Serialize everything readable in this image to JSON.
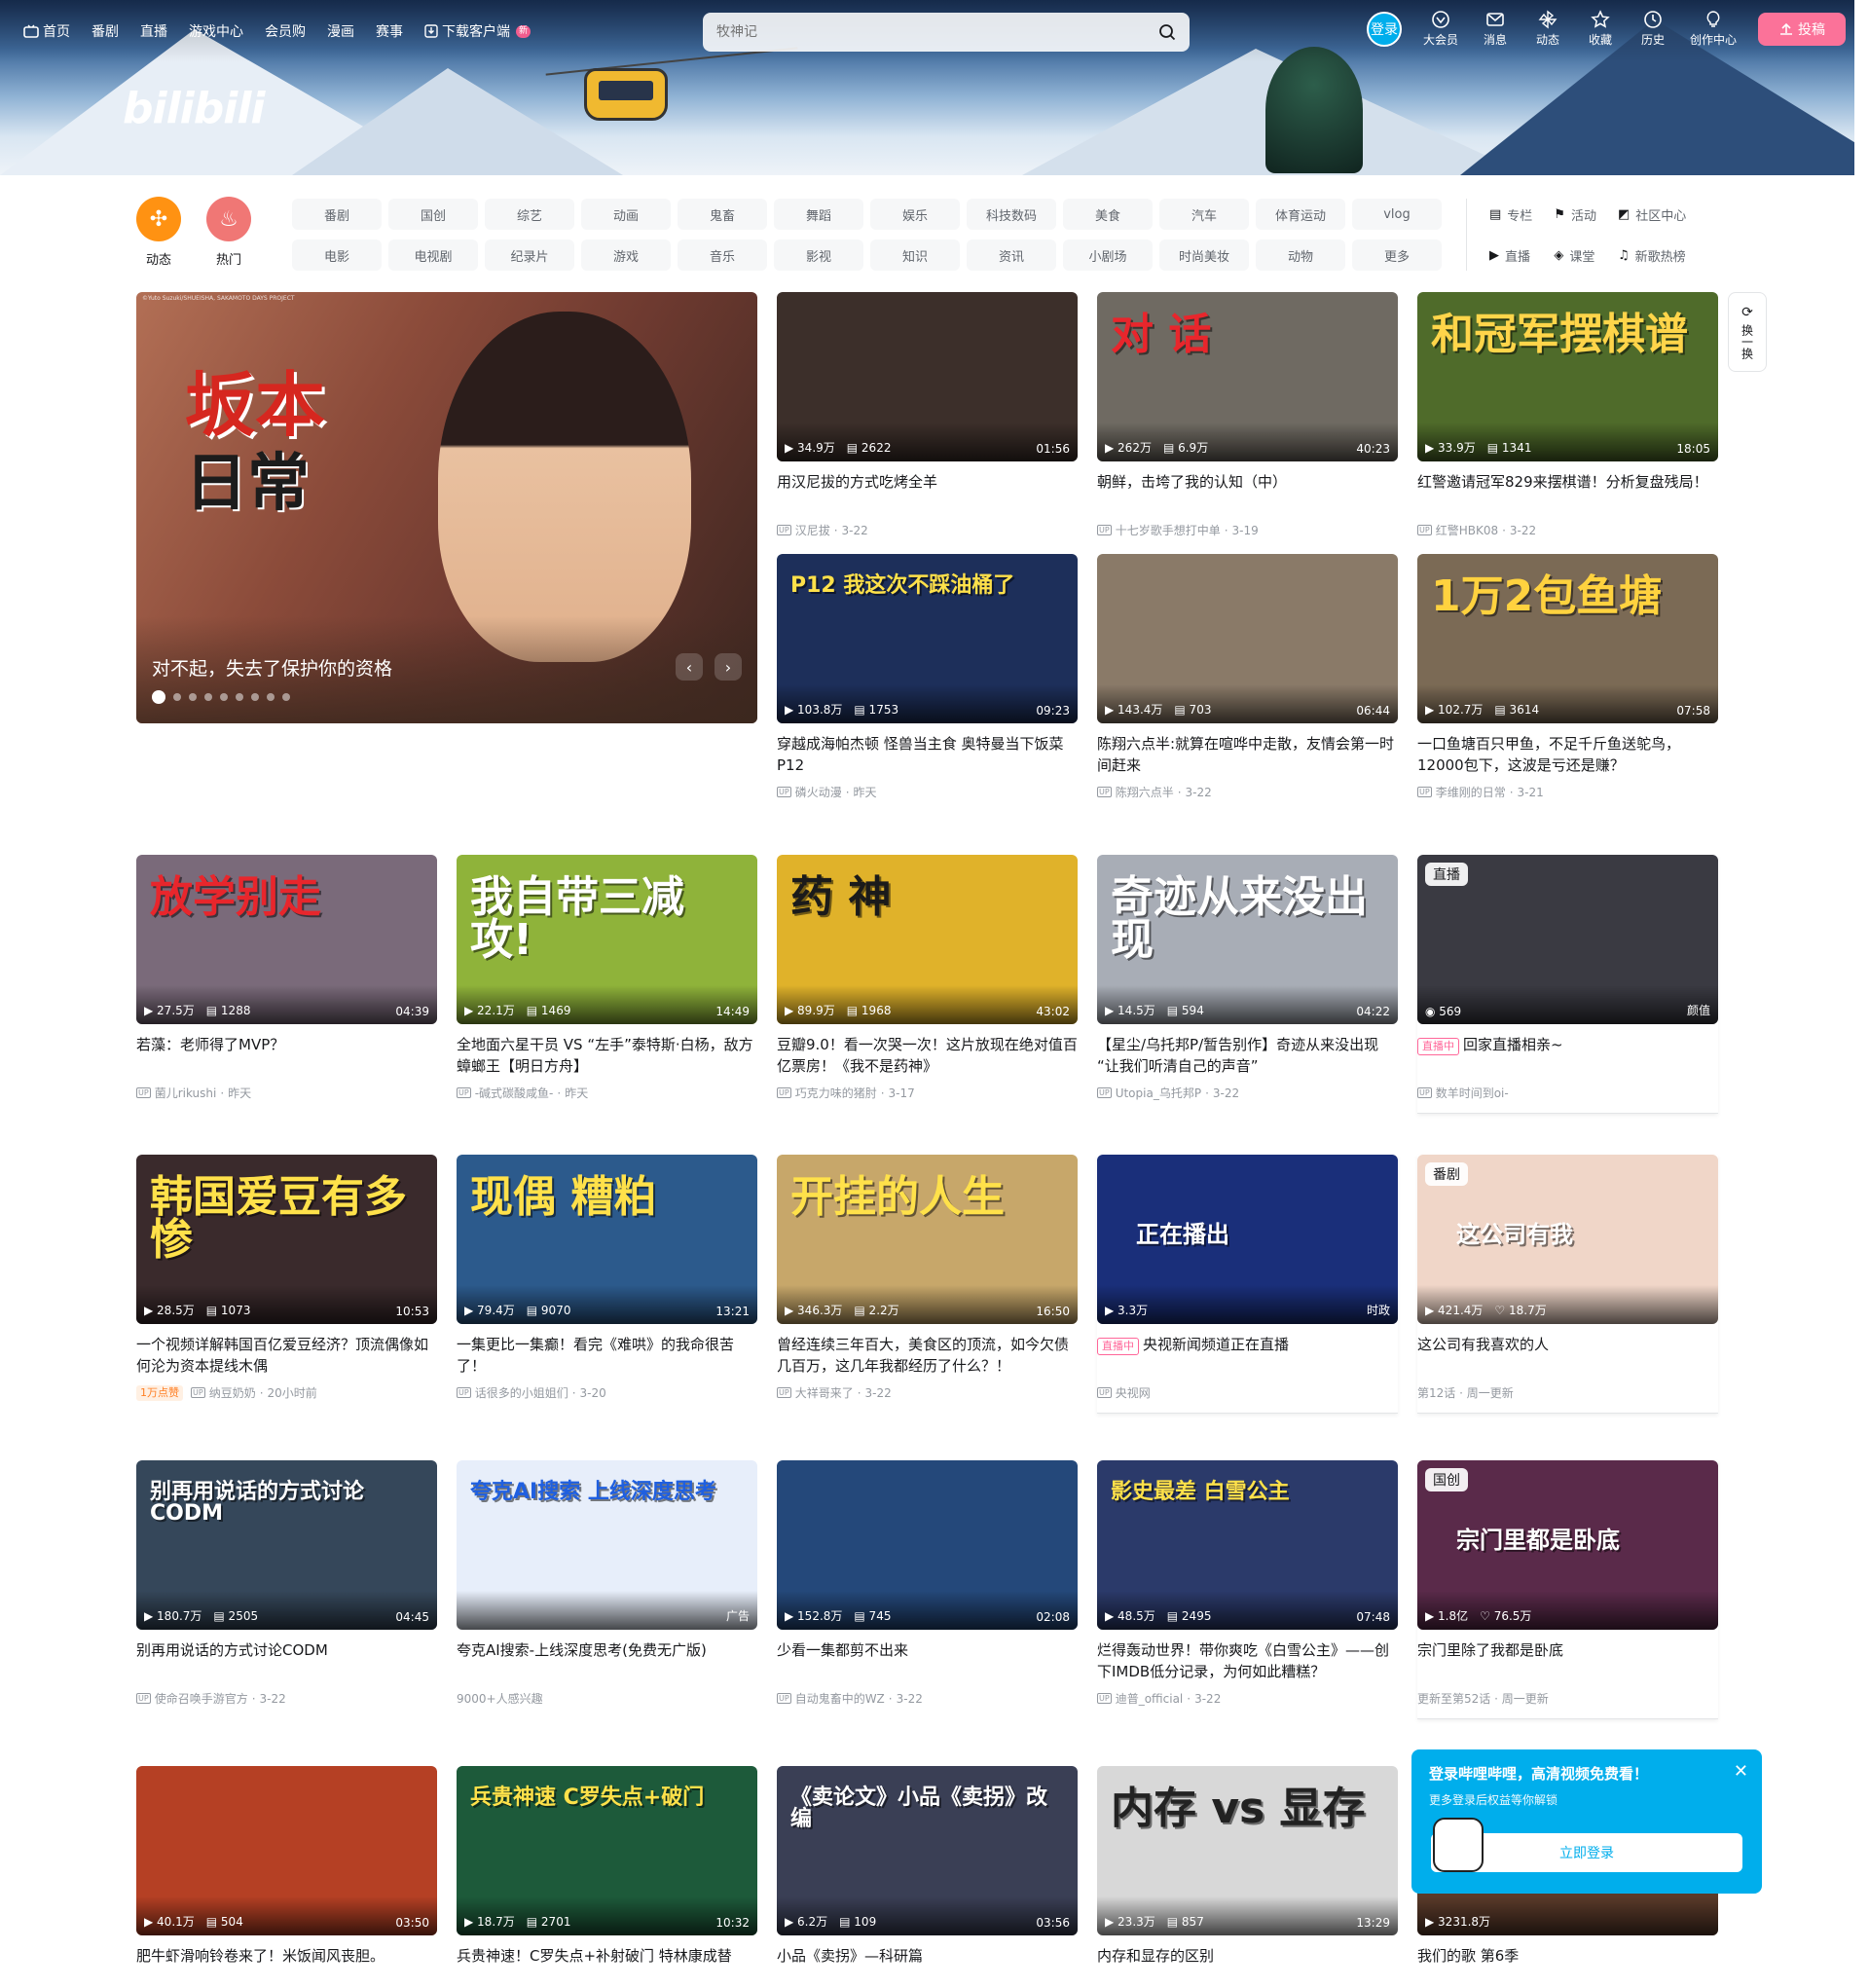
{
  "nav": {
    "left": [
      "首页",
      "番剧",
      "直播",
      "游戏中心",
      "会员购",
      "漫画",
      "赛事",
      "下载客户端"
    ],
    "new_badge": "新",
    "search_placeholder": "牧神记",
    "login": "登录",
    "right": [
      "大会员",
      "消息",
      "动态",
      "收藏",
      "历史",
      "创作中心"
    ],
    "upload": "投稿"
  },
  "logo": "bilibili",
  "quick": [
    {
      "label": "动态",
      "color": "#ff9212",
      "icon": "windmill-icon"
    },
    {
      "label": "热门",
      "color": "#f07775",
      "icon": "fire-icon"
    }
  ],
  "channels": [
    "番剧",
    "国创",
    "综艺",
    "动画",
    "鬼畜",
    "舞蹈",
    "娱乐",
    "科技数码",
    "美食",
    "汽车",
    "体育运动",
    "vlog",
    "电影",
    "电视剧",
    "纪录片",
    "游戏",
    "音乐",
    "影视",
    "知识",
    "资讯",
    "小剧场",
    "时尚美妆",
    "动物",
    "更多"
  ],
  "side_links": [
    "专栏",
    "活动",
    "社区中心",
    "直播",
    "课堂",
    "新歌热榜"
  ],
  "carousel": {
    "title": "对不起，失去了保护你的资格",
    "logo_line1": "坂本",
    "logo_line2": "日常",
    "copyright": "©Yuto Suzuki/SHUEISHA, SAKAMOTO DAYS PROJECT"
  },
  "refresh": "换一换",
  "cards": [
    {
      "views": "34.9万",
      "danmaku": "2622",
      "dur": "01:56",
      "title": "用汉尼拔的方式吃烤全羊",
      "up": "汉尼拔",
      "date": "3-22",
      "bg": "#3c2f2a",
      "word": "",
      "wc": "#fff"
    },
    {
      "views": "262万",
      "danmaku": "6.9万",
      "dur": "40:23",
      "title": "朝鲜，击垮了我的认知（中）",
      "up": "十七岁歌手想打中单",
      "date": "3-19",
      "bg": "#6f6a62",
      "word": "对 话",
      "wc": "#e8262c"
    },
    {
      "views": "33.9万",
      "danmaku": "1341",
      "dur": "18:05",
      "title": "红警邀请冠军829来摆棋谱！分析复盘残局！",
      "up": "红警HBK08",
      "date": "3-22",
      "bg": "#4f6b2a",
      "word": "和冠军摆棋谱",
      "wc": "#ffd54a"
    },
    {
      "views": "103.8万",
      "danmaku": "1753",
      "dur": "09:23",
      "title": "穿越成海帕杰顿 怪兽当主食 奥特曼当下饭菜P12",
      "up": "磷火动漫",
      "date": "昨天",
      "bg": "#1d2f5a",
      "word": "P12 我这次不踩油桶了",
      "wc": "#ffe14a"
    },
    {
      "views": "143.4万",
      "danmaku": "703",
      "dur": "06:44",
      "title": "陈翔六点半:就算在喧哗中走散，友情会第一时间赶来",
      "up": "陈翔六点半",
      "date": "3-22",
      "bg": "#8a7a68",
      "word": "",
      "wc": "#fff"
    },
    {
      "views": "102.7万",
      "danmaku": "3614",
      "dur": "07:58",
      "title": "一口鱼塘百只甲鱼，不足千斤鱼送鸵鸟，12000包下，这波是亏还是赚？",
      "up": "李维刚的日常",
      "date": "3-21",
      "bg": "#7b6a55",
      "word": "1万2包鱼塘",
      "wc": "#ffd23f"
    },
    {
      "views": "27.5万",
      "danmaku": "1288",
      "dur": "04:39",
      "title": "若藻：老师得了MVP？",
      "up": "菌儿rikushi",
      "date": "昨天",
      "bg": "#7a6a7a",
      "word": "放学别走",
      "wc": "#e8262c"
    },
    {
      "views": "22.1万",
      "danmaku": "1469",
      "dur": "14:49",
      "title": "全地面六星干员 VS “左手”泰特斯·白杨，敌方蟑螂王【明日方舟】",
      "up": "-碱式碳酸咸鱼-",
      "date": "昨天",
      "bg": "#8fb33a",
      "word": "我自带三减攻!",
      "wc": "#fff"
    },
    {
      "views": "89.9万",
      "danmaku": "1968",
      "dur": "43:02",
      "title": "豆瓣9.0！看一次哭一次！这片放现在绝对值百亿票房！《我不是药神》",
      "up": "巧克力味的猪肘",
      "date": "3-17",
      "bg": "#e0b22a",
      "word": "药 神",
      "wc": "#1b1b1b"
    },
    {
      "views": "14.5万",
      "danmaku": "594",
      "dur": "04:22",
      "title": "【星尘/乌托邦P/暂告别作】奇迹从来没出现 “让我们听清自己的声音”",
      "up": "Utopia_乌托邦P",
      "date": "3-22",
      "bg": "#a8adb6",
      "word": "奇迹从来没出现",
      "wc": "#fff"
    },
    {
      "views": "28.5万",
      "danmaku": "1073",
      "dur": "10:53",
      "title": "一个视频详解韩国百亿爱豆经济？顶流偶像如何沦为资本提线木偶",
      "up": "纳豆奶奶",
      "date": "20小时前",
      "bg": "#3a2a2c",
      "word": "韩国爱豆有多惨",
      "wc": "#ffe14a",
      "hot": "1万点赞"
    },
    {
      "views": "79.4万",
      "danmaku": "9070",
      "dur": "13:21",
      "title": "一集更比一集癫！看完《难哄》的我命很苦了！",
      "up": "话很多的小姐姐们",
      "date": "3-20",
      "bg": "#2c5a8c",
      "word": "现偶 糟粕",
      "wc": "#ffe14a"
    },
    {
      "views": "346.3万",
      "danmaku": "2.2万",
      "dur": "16:50",
      "title": "曾经连续三年百大，美食区的顶流，如今欠债几百万，这几年我都经历了什么？！",
      "up": "大祥哥来了",
      "date": "3-22",
      "bg": "#c7a76a",
      "word": "开挂的人生",
      "wc": "#ffe14a"
    },
    {
      "views": "180.7万",
      "danmaku": "2505",
      "dur": "04:45",
      "title": "别再用说话的方式讨论CODM",
      "up": "使命召唤手游官方",
      "date": "3-22",
      "bg": "#35475a",
      "word": "别再用说话的方式讨论CODM",
      "wc": "#fff"
    },
    {
      "views": "",
      "danmaku": "",
      "dur": "广告",
      "title": "夸克AI搜索-上线深度思考(免费无广版)",
      "up": "",
      "date": "",
      "extra": "9000+人感兴趣",
      "bg": "#e7eefa",
      "word": "夸克AI搜索 上线深度思考",
      "wc": "#1f5fe0"
    },
    {
      "views": "152.8万",
      "danmaku": "745",
      "dur": "02:08",
      "title": "少看一集都剪不出来",
      "up": "自动鬼畜中的WZ",
      "date": "3-22",
      "bg": "#24487a",
      "word": "",
      "wc": "#fff"
    },
    {
      "views": "48.5万",
      "danmaku": "2495",
      "dur": "07:48",
      "title": "烂得轰动世界！带你爽吃《白雪公主》——创下IMDB低分记录，为何如此糟糕？",
      "up": "迪普_official",
      "date": "3-22",
      "bg": "#2b3a6a",
      "word": "影史最差 白雪公主",
      "wc": "#ffe14a"
    },
    {
      "views": "40.1万",
      "danmaku": "504",
      "dur": "03:50",
      "title": "肥牛虾滑响铃卷来了！米饭闻风丧胆。",
      "up": "",
      "date": "",
      "bg": "#b54024",
      "word": "",
      "wc": "#fff"
    },
    {
      "views": "18.7万",
      "danmaku": "2701",
      "dur": "10:32",
      "title": "兵贵神速！C罗失点+补射破门 特林康成替",
      "up": "",
      "date": "",
      "bg": "#1d5a3a",
      "word": "兵贵神速 C罗失点+破门",
      "wc": "#ffe14a"
    },
    {
      "views": "6.2万",
      "danmaku": "109",
      "dur": "03:56",
      "title": "小品《卖拐》—科研篇",
      "up": "",
      "date": "",
      "bg": "#3a3f55",
      "word": "《卖论文》小品《卖拐》改编",
      "wc": "#fff"
    },
    {
      "views": "23.3万",
      "danmaku": "857",
      "dur": "13:29",
      "title": "内存和显存的区别",
      "up": "",
      "date": "",
      "bg": "#d8d8d8",
      "word": "内存 vs 显存",
      "wc": "#222"
    }
  ],
  "special": [
    {
      "tag": "直播",
      "viewers": "569",
      "area": "颜值",
      "live": "直播中",
      "title": "回家直播相亲~",
      "up": "数羊时间到oi-",
      "bg": "#3a3a42"
    },
    {
      "tag": "番剧",
      "views": "421.4万",
      "likes": "18.7万",
      "title": "这公司有我喜欢的人",
      "sub": "第12话 · 周一更新",
      "bg": "#f0d6c8",
      "word": "这公司有我"
    },
    {
      "tag": "",
      "views": "3.3万",
      "area": "时政",
      "live": "直播中",
      "title": "央视新闻频道正在直播",
      "up": "央视网",
      "bg": "#1a2f7a",
      "word": "正在播出"
    },
    {
      "tag": "国创",
      "views": "1.8亿",
      "likes": "76.5万",
      "title": "宗门里除了我都是卧底",
      "sub": "更新至第52话 · 周一更新",
      "bg": "#5a2a4a",
      "word": "宗门里都是卧底"
    },
    {
      "views": "3231.8万",
      "title": "我们的歌 第6季",
      "bg": "#5a3a2a"
    }
  ],
  "popup": {
    "title": "登录哔哩哔哩，高清视频免费看！",
    "sub": "更多登录后权益等你解锁",
    "btn": "立即登录"
  }
}
